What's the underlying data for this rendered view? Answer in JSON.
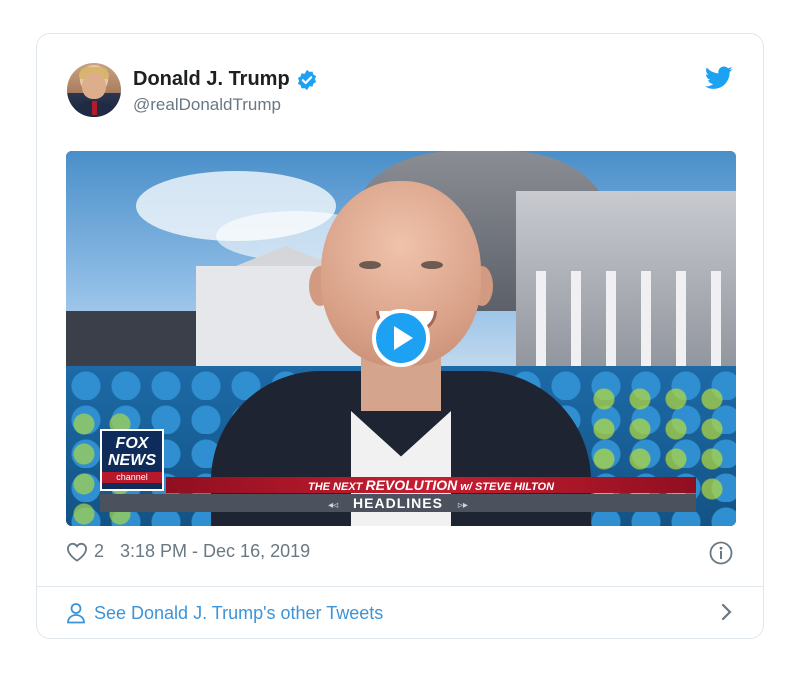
{
  "tweet": {
    "author": {
      "display_name": "Donald J. Trump",
      "handle": "@realDonaldTrump",
      "verified": true,
      "avatar_icon": "user-avatar"
    },
    "brand_icon": "twitter-bird-icon",
    "media": {
      "type": "video",
      "play_icon": "play-icon",
      "overlay": {
        "logo_line1": "FOX",
        "logo_line2": "NEWS",
        "logo_line3": "channel",
        "show_prefix": "THE NEXT",
        "show_title": "REVOLUTION",
        "show_suffix": "w/ STEVE HILTON",
        "headline": "HEADLINES",
        "arrow_left": "◂◃",
        "arrow_right": "▹▸"
      }
    },
    "like_count": "2",
    "timestamp": "3:18 PM - Dec 16, 2019",
    "footer_link": "See Donald J. Trump's other Tweets"
  },
  "colors": {
    "accent": "#1da1f2",
    "link": "#3b94d9",
    "muted": "#697882",
    "text": "#1c2022",
    "border": "#e1e8ed"
  }
}
